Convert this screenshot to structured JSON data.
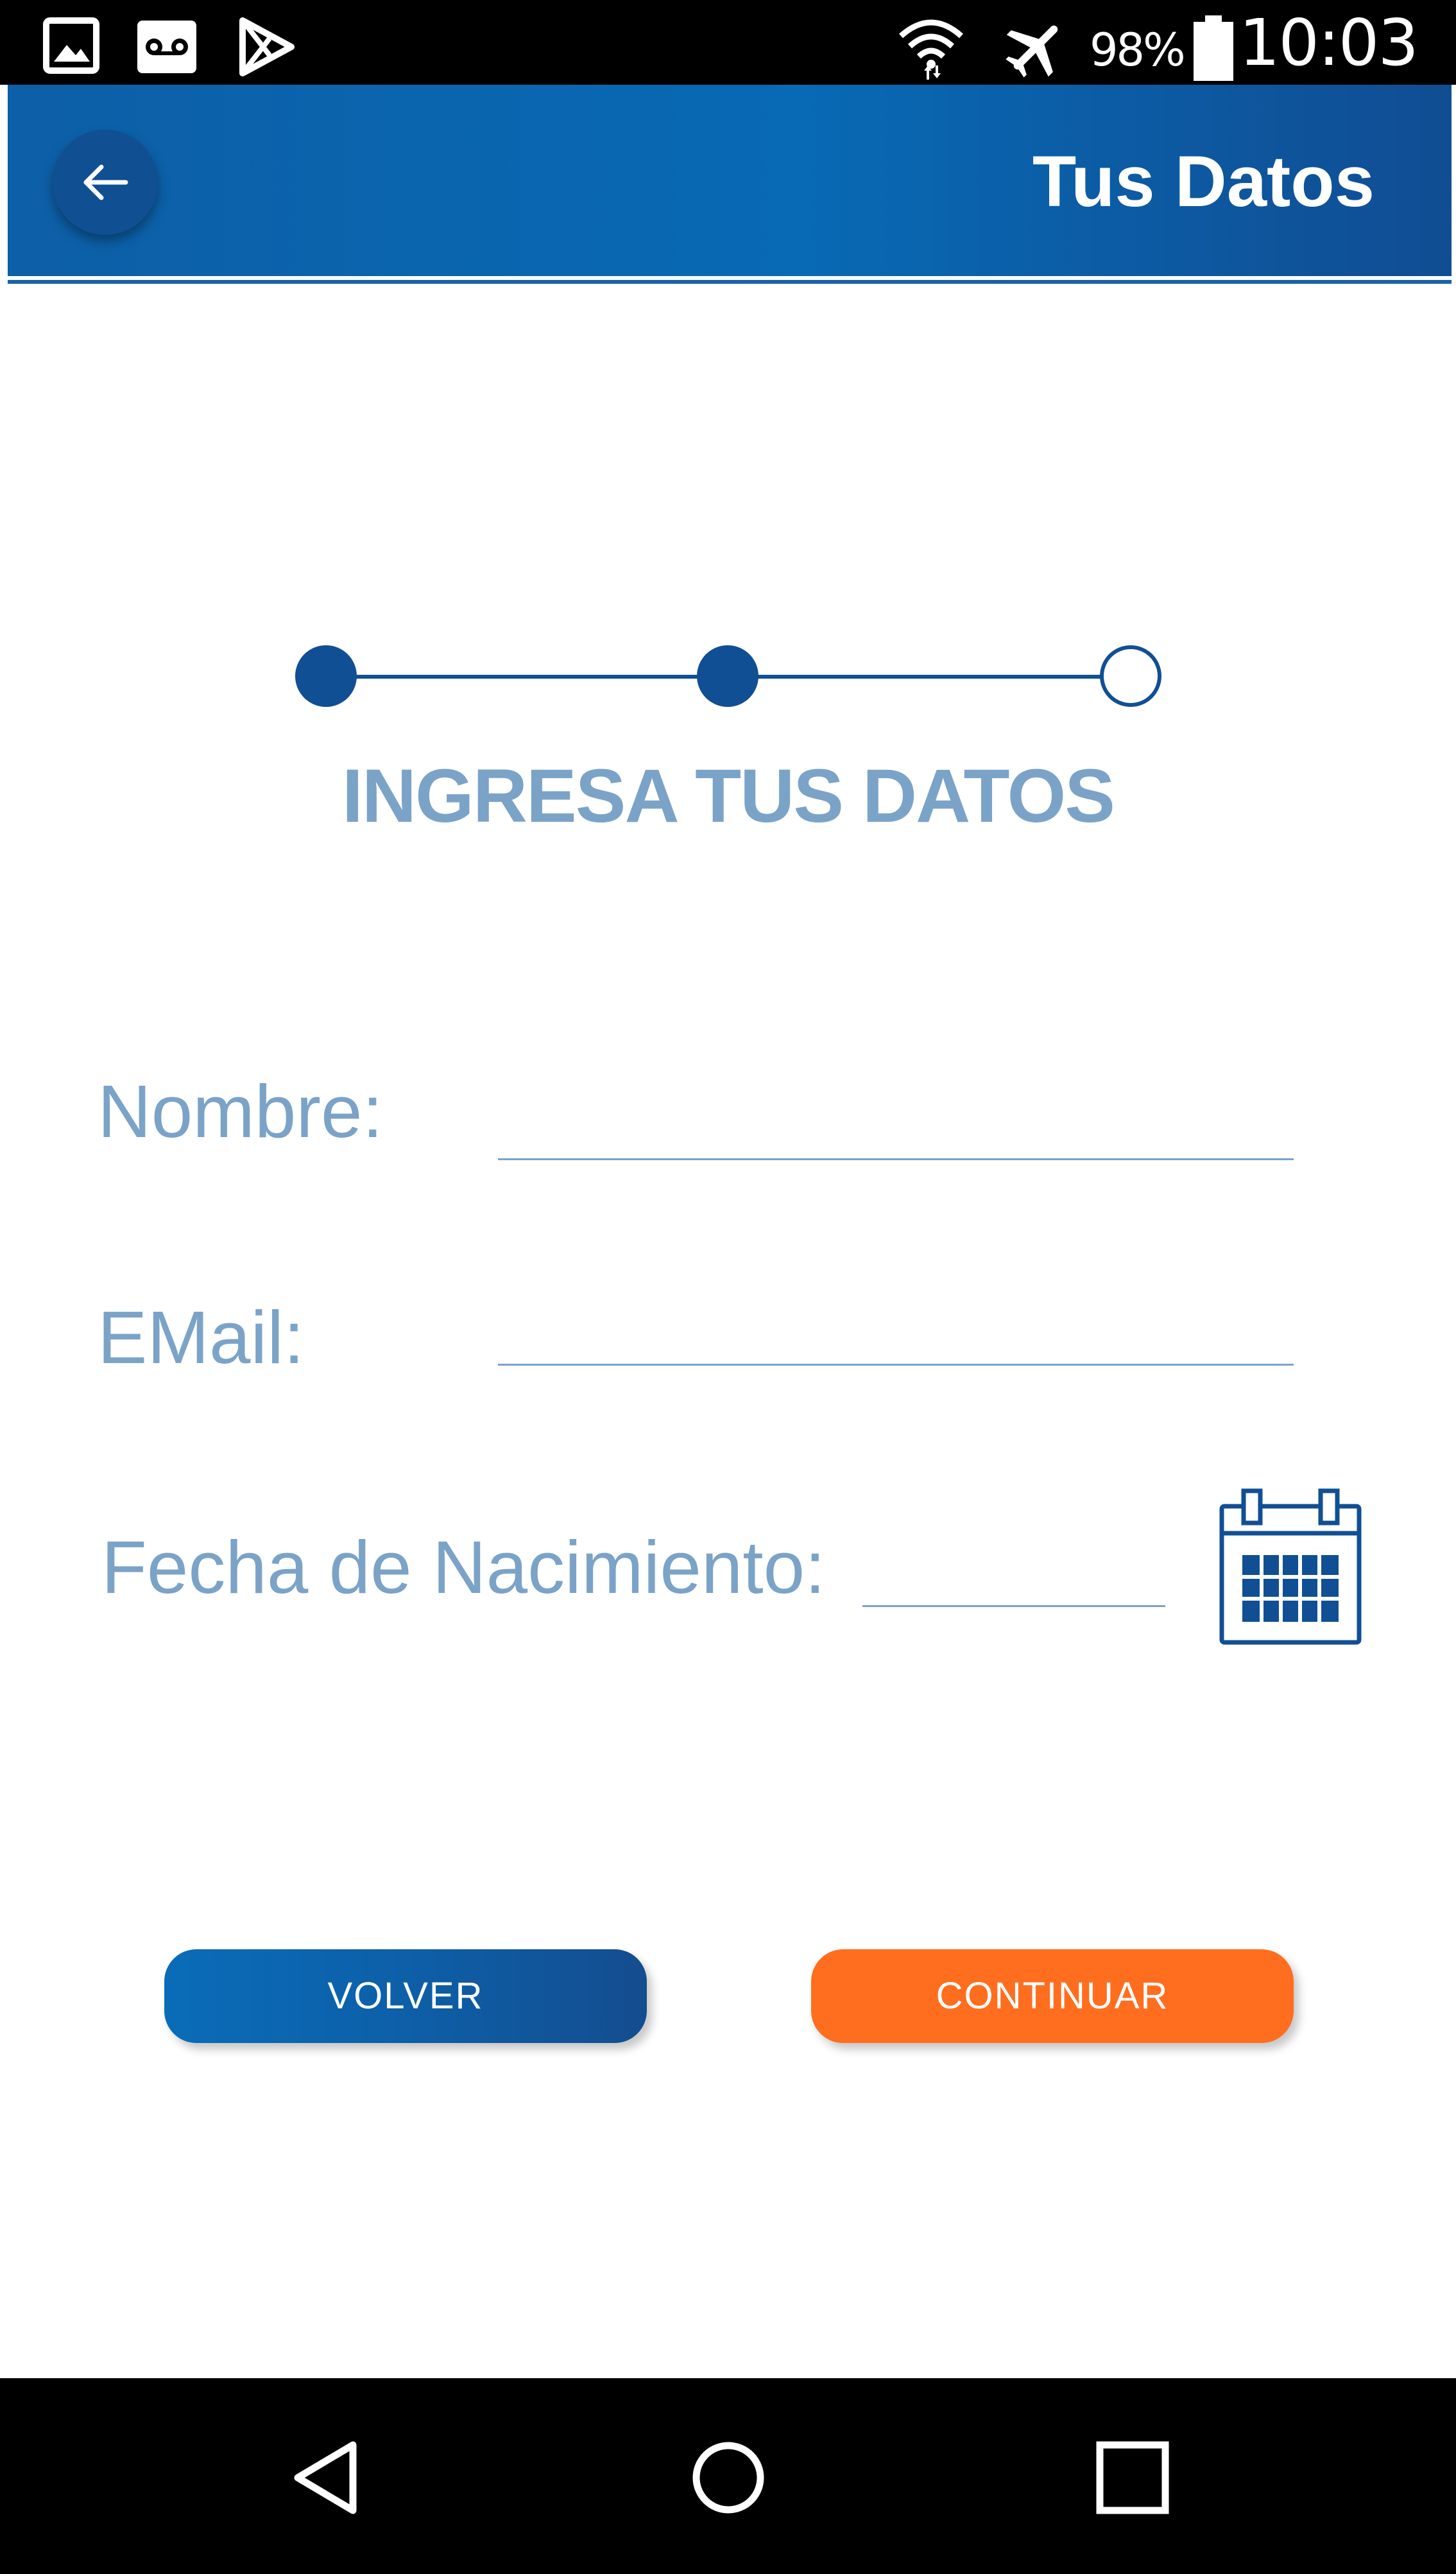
{
  "status_bar": {
    "time": "10:03",
    "battery_percent": "98%",
    "left_icons": [
      "gallery-icon",
      "voicemail-icon",
      "play-store-icon"
    ],
    "right_icons": [
      "wifi-icon",
      "airplane-mode-icon",
      "battery-icon"
    ]
  },
  "app_bar": {
    "title": "Tus Datos",
    "back_icon": "arrow-left-icon"
  },
  "stepper": {
    "total_steps": 3,
    "completed_steps": 2
  },
  "form": {
    "heading": "INGRESA TUS DATOS",
    "name_label": "Nombre:",
    "name_value": "",
    "email_label": "EMail:",
    "email_value": "",
    "birthdate_label": "Fecha de Nacimiento:",
    "birthdate_value": "",
    "calendar_icon": "calendar-icon"
  },
  "actions": {
    "back_label": "VOLVER",
    "continue_label": "CONTINUAR"
  },
  "nav_bar": {
    "icons": [
      "nav-back-icon",
      "nav-home-icon",
      "nav-recents-icon"
    ]
  },
  "colors": {
    "primary": "#0d5fa7",
    "primary_dark": "#104f94",
    "accent": "#ff6e1f",
    "label": "#7ba3c8"
  }
}
